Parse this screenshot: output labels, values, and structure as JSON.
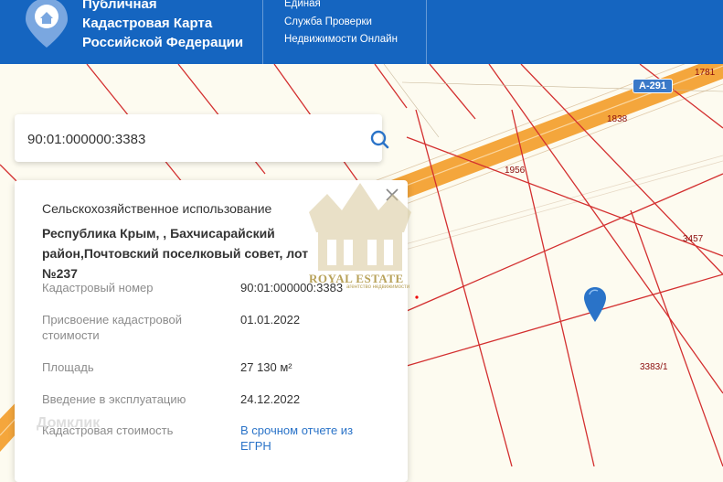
{
  "header": {
    "title_lines": [
      "Публичная",
      "Кадастровая Карта",
      "Российской Федерации"
    ],
    "service_lines": [
      "Единая",
      "Служба Проверки",
      "Недвижимости Онлайн"
    ],
    "logo_icon": "house-pin-icon"
  },
  "map": {
    "road_badge": "А-291",
    "parcel_labels": {
      "p1781": "1781",
      "p1838": "1838",
      "p1956": "1956",
      "p3457": "3457",
      "p3383_1": "3383/1"
    },
    "marker_icon": "map-pin-icon"
  },
  "search": {
    "value": "90:01:000000:3383",
    "icon": "search-icon"
  },
  "panel": {
    "category": "Сельскохозяйственное использование",
    "address": "Республика Крым, , Бахчисарайский район,Почтовский поселковый совет, лот №237",
    "properties": [
      {
        "label": "Кадастровый номер",
        "value": "90:01:000000:3383"
      },
      {
        "label": "Присвоение кадастровой стоимости",
        "value": "01.01.2022"
      },
      {
        "label": "Площадь",
        "value": "27 130 м²"
      },
      {
        "label": "Введение в эксплуатацию",
        "value": "24.12.2022"
      },
      {
        "label": "Кадастровая стоимость",
        "value": "В срочном отчете из ЕГРН"
      }
    ]
  },
  "watermark": {
    "text": "ROYAL ESTATE",
    "sub": "агентство недвижимости",
    "text2": "Домклик"
  },
  "colors": {
    "header_bg": "#1565c0",
    "parcel_line": "#d32f2f",
    "road": "#f4a63c",
    "link": "#2a73c8"
  }
}
